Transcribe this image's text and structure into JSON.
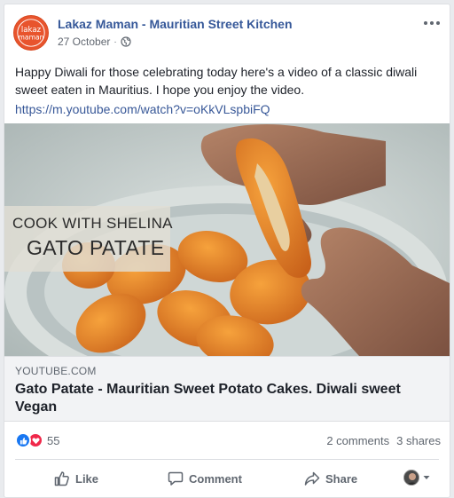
{
  "post": {
    "page_name": "Lakaz Maman - Mauritian Street Kitchen",
    "date": "27 October",
    "separator": "·",
    "text": "Happy Diwali for those celebrating today here's a video of a classic diwali sweet eaten in Mauritius. I hope you enjoy the video.",
    "url": "https://m.youtube.com/watch?v=oKkVLspbiFQ",
    "avatar_text": [
      "lakaz",
      "maman"
    ]
  },
  "video": {
    "overlay_line1": "COOK WITH SHELINA",
    "overlay_line2": "GATO PATATE"
  },
  "link_preview": {
    "domain": "YOUTUBE.COM",
    "title": "Gato Patate - Mauritian Sweet Potato Cakes. Diwali sweet Vegan"
  },
  "stats": {
    "reaction_count": "55",
    "comments": "2 comments",
    "shares": "3 shares"
  },
  "actions": {
    "like": "Like",
    "comment": "Comment",
    "share": "Share"
  },
  "colors": {
    "link": "#385898",
    "page_name": "#365899",
    "like_blue": "#1877f2",
    "love_red": "#f0284a",
    "avatar_orange": "#e8542d"
  },
  "icons": [
    "globe-icon",
    "more-options-icon",
    "like-reaction-icon",
    "love-reaction-icon",
    "thumbs-up-icon",
    "comment-icon",
    "share-icon",
    "chevron-down-icon"
  ]
}
